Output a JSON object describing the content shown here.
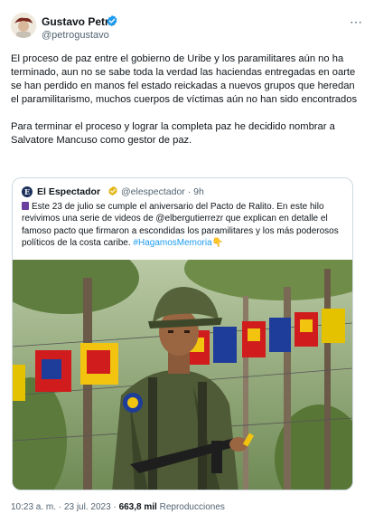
{
  "author": {
    "name": "Gustavo Petro",
    "handle": "@petrogustavo",
    "avatar_icon": "avatar-photo-icon"
  },
  "post": {
    "paragraph1": "El proceso de paz  entre el gobierno de Uribe y los paramilitares aún no ha terminado, aun no se sabe toda la verdad las haciendas entregadas en oarte se han perdido en manos fel estado reickadas a nuevos grupos que heredan el paramilitarismo, muchos cuerpos de víctimas aún no han sido encontrados",
    "paragraph2": "Para terminar el proceso y lograr la completa paz he decidido nombrar a Salvatore Mancuso como gestor de paz."
  },
  "quote": {
    "logo_letter": "E",
    "name": "El Espectador",
    "handle": "@elespectador",
    "separator": "·",
    "time": "9h",
    "text": "Este 23 de julio se cumple el aniversario del Pacto de Ralito. En este hilo revivimos una serie de videos de @elbergutierrezr que explican en detalle el famoso pacto que firmaron a escondidas los paramilitares y los más poderosos políticos de la costa caribe.",
    "hashtag": "#HagamosMemoria",
    "emoji": "👇",
    "photo_icon": "soldier-photo-icon"
  },
  "footer": {
    "time": "10:23 a. m.",
    "separator1": "·",
    "date": "23 jul. 2023",
    "separator2": "·",
    "views": "663,8 mil",
    "views_label": "Reproducciones"
  },
  "colors": {
    "link": "#1d9bf0",
    "verified": "#1d9bf0",
    "secondary_text": "#536471",
    "border": "#cfd9de"
  }
}
